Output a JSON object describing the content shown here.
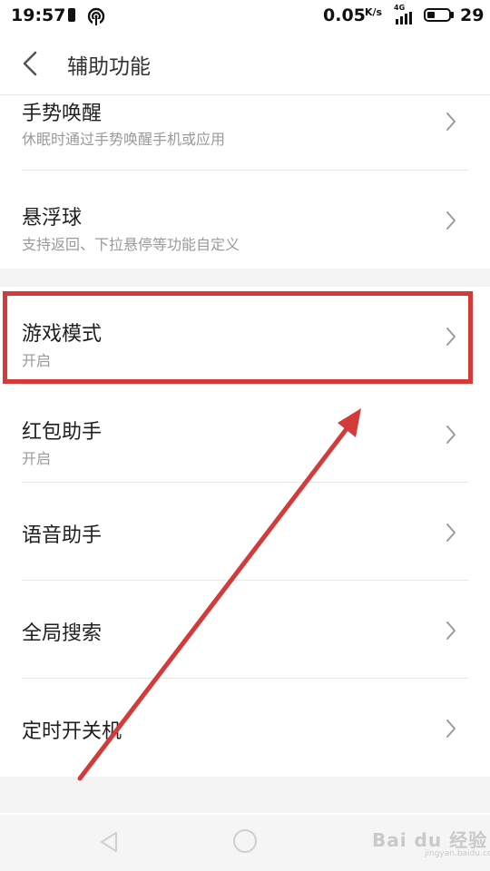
{
  "status_bar": {
    "time": "19:57",
    "speed": "0.05",
    "speed_unit": "K/s",
    "network": "4G",
    "battery_level": "29"
  },
  "header": {
    "title": "辅助功能"
  },
  "items": [
    {
      "title": "手势唤醒",
      "subtitle": "休眠时通过手势唤醒手机或应用"
    },
    {
      "title": "悬浮球",
      "subtitle": "支持返回、下拉悬停等功能自定义"
    },
    {
      "title": "游戏模式",
      "subtitle": "开启"
    },
    {
      "title": "红包助手",
      "subtitle": "开启"
    },
    {
      "title": "语音助手"
    },
    {
      "title": "全局搜索"
    },
    {
      "title": "定时开关机"
    }
  ],
  "watermark": {
    "text": "Bai du 经验",
    "sub": "jingyan.baidu.com"
  },
  "colors": {
    "annotation": "#d33b3b",
    "separator": "#f3f3f3"
  }
}
